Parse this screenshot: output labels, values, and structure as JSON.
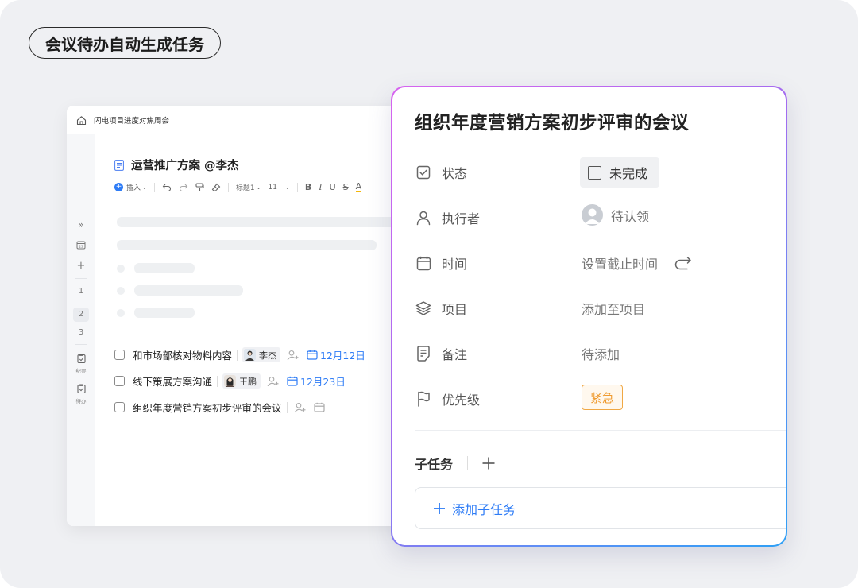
{
  "badge_label": "会议待办自动生成任务",
  "doc": {
    "breadcrumb": "闪电项目进度对焦周会",
    "title": "运营推广方案 @李杰",
    "toolbar": {
      "insert": "插入",
      "heading": "标题1",
      "font_size": "11",
      "bold": "B",
      "italic": "I",
      "underline": "U",
      "strike": "S",
      "font_color": "A"
    },
    "rail": {
      "expand": "»",
      "calendar": "23",
      "add": "+",
      "pages": [
        "1",
        "2",
        "3"
      ],
      "selected_page": "2",
      "minutes_label": "纪要",
      "todo_label": "待办"
    },
    "tasks": [
      {
        "text": "和市场部核对物料内容",
        "assignee": "李杰",
        "due": "12月12日"
      },
      {
        "text": "线下策展方案沟通",
        "assignee": "王鹏",
        "due": "12月23日"
      },
      {
        "text": "组织年度营销方案初步评审的会议",
        "assignee": "",
        "due": ""
      }
    ]
  },
  "task_card": {
    "title": "组织年度营销方案初步评审的会议",
    "fields": {
      "status": {
        "label": "状态",
        "value": "未完成"
      },
      "assignee": {
        "label": "执行者",
        "value": "待认领"
      },
      "time": {
        "label": "时间",
        "value": "设置截止时间"
      },
      "project": {
        "label": "项目",
        "value": "添加至项目"
      },
      "notes": {
        "label": "备注",
        "value": "待添加"
      },
      "priority": {
        "label": "优先级",
        "value": "紧急"
      }
    },
    "subtasks": {
      "header": "子任务",
      "add_label": "添加子任务"
    }
  },
  "colors": {
    "accent_blue": "#2e7cf6",
    "urgent_orange": "#ef9a2e",
    "card_border_start": "#d764ef",
    "card_border_end": "#2fa0f5"
  }
}
